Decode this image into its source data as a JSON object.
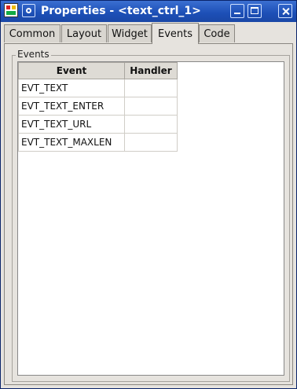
{
  "window": {
    "title": "Properties - <text_ctrl_1>"
  },
  "tabs": [
    "Common",
    "Layout",
    "Widget",
    "Events",
    "Code"
  ],
  "active_tab": "Events",
  "events_group": {
    "label": "Events",
    "columns": [
      "Event",
      "Handler"
    ],
    "rows": [
      {
        "event": "EVT_TEXT",
        "handler": ""
      },
      {
        "event": "EVT_TEXT_ENTER",
        "handler": ""
      },
      {
        "event": "EVT_TEXT_URL",
        "handler": ""
      },
      {
        "event": "EVT_TEXT_MAXLEN",
        "handler": ""
      }
    ]
  },
  "colors": {
    "titlebar": "#1c4fb6",
    "panel": "#e6e3de"
  }
}
